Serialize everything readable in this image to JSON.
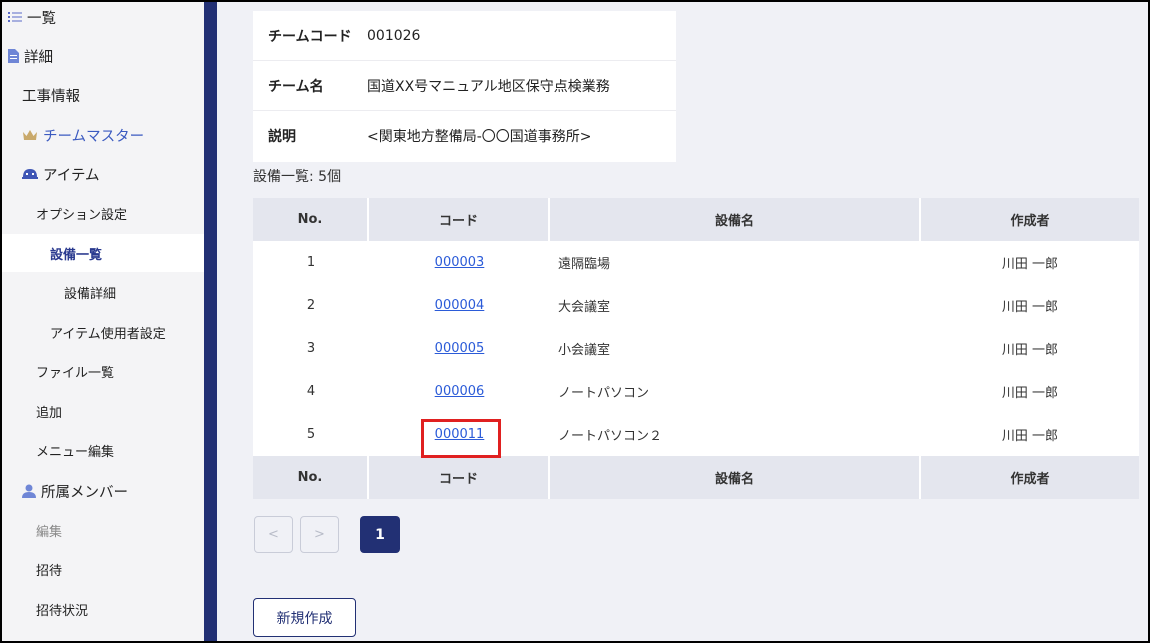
{
  "sidebar": {
    "items": [
      {
        "label": "一覧",
        "icon": "list-icon"
      },
      {
        "label": "詳細",
        "icon": "document-icon"
      },
      {
        "label": "工事情報"
      },
      {
        "label": "チームマスター",
        "icon": "crown-icon"
      },
      {
        "label": "アイテム",
        "icon": "helmet-icon"
      },
      {
        "label": "オプション設定"
      },
      {
        "label": "設備一覧"
      },
      {
        "label": "設備詳細"
      },
      {
        "label": "アイテム使用者設定"
      },
      {
        "label": "ファイル一覧"
      },
      {
        "label": "追加"
      },
      {
        "label": "メニュー編集"
      },
      {
        "label": "所属メンバー",
        "icon": "person-icon"
      },
      {
        "label": "編集"
      },
      {
        "label": "招待"
      },
      {
        "label": "招待状況"
      }
    ]
  },
  "team": {
    "code_label": "チームコード",
    "code_value": "001026",
    "name_label": "チーム名",
    "name_value": "国道XX号マニュアル地区保守点検業務",
    "desc_label": "説明",
    "desc_value": "<関東地方整備局-〇〇国道事務所>"
  },
  "equipment": {
    "count_text": "設備一覧: 5個",
    "columns": [
      "No.",
      "コード",
      "設備名",
      "作成者"
    ],
    "rows": [
      {
        "no": "1",
        "code": "000003",
        "name": "遠隔臨場",
        "creator": "川田 一郎"
      },
      {
        "no": "2",
        "code": "000004",
        "name": "大会議室",
        "creator": "川田 一郎"
      },
      {
        "no": "3",
        "code": "000005",
        "name": "小会議室",
        "creator": "川田 一郎"
      },
      {
        "no": "4",
        "code": "000006",
        "name": "ノートパソコン",
        "creator": "川田 一郎"
      },
      {
        "no": "5",
        "code": "000011",
        "name": "ノートパソコン２",
        "creator": "川田 一郎"
      }
    ]
  },
  "pagination": {
    "prev": "<",
    "next": ">",
    "current": "1"
  },
  "actions": {
    "new_label": "新規作成"
  },
  "colors": {
    "accent": "#223074",
    "link": "#2b5bd8",
    "highlight": "#e02020"
  }
}
